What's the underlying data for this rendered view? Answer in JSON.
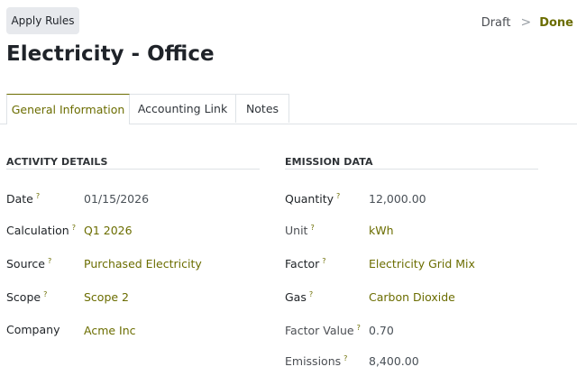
{
  "header": {
    "apply_rules_label": "Apply Rules",
    "status": {
      "draft": "Draft",
      "separator": ">",
      "done": "Done"
    }
  },
  "record": {
    "title": "Electricity - Office"
  },
  "tabs": [
    {
      "label": "General Information",
      "active": true
    },
    {
      "label": "Accounting Link",
      "active": false
    },
    {
      "label": "Notes",
      "active": false
    }
  ],
  "activity": {
    "title": "ACTIVITY DETAILS",
    "fields": [
      {
        "label": "Date",
        "help": "?",
        "value": "01/15/2026"
      },
      {
        "label": "Calculation",
        "help": "?",
        "value": "Q1 2026"
      },
      {
        "label": "Source",
        "help": "?",
        "value": "Purchased Electricity"
      },
      {
        "label": "Scope",
        "help": "?",
        "value": "Scope 2"
      },
      {
        "label": "Company",
        "help": "",
        "value": "Acme Inc"
      }
    ]
  },
  "emission": {
    "title": "EMISSION DATA",
    "fields": [
      {
        "label": "Quantity",
        "help": "?",
        "value": "12,000.00"
      },
      {
        "label": "Unit",
        "help": "?",
        "value": "kWh"
      },
      {
        "label": "Factor",
        "help": "?",
        "value": "Electricity Grid Mix"
      },
      {
        "label": "Gas",
        "help": "?",
        "value": "Carbon Dioxide"
      },
      {
        "label": "Factor Value",
        "help": "?",
        "value": "0.70"
      },
      {
        "label": "Emissions",
        "help": "?",
        "value": "8,400.00"
      }
    ]
  },
  "colors": {
    "accent": "#6b6d00",
    "button_bg": "#e7e9ed",
    "border": "#dee2e6"
  }
}
